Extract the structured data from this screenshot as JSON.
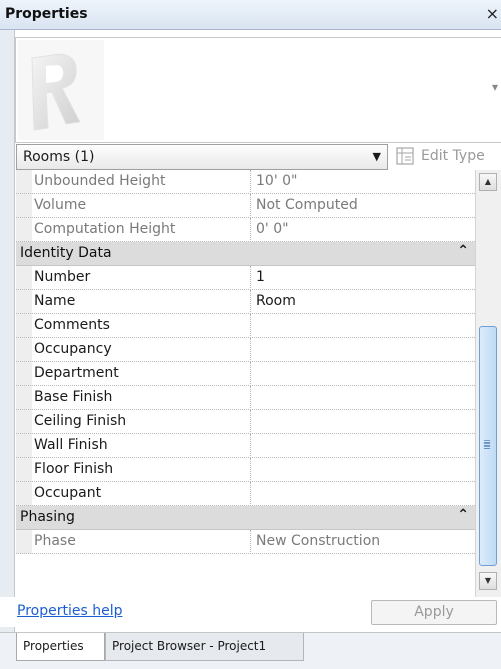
{
  "window": {
    "title": "Properties",
    "close": "×"
  },
  "type_selector": {
    "value": "Rooms (1)",
    "edit_type": "Edit Type"
  },
  "rows": [
    {
      "kind": "prop",
      "readonly": true,
      "key": "Unbounded Height",
      "value": "10'  0\""
    },
    {
      "kind": "prop",
      "readonly": true,
      "key": "Volume",
      "value": "Not Computed"
    },
    {
      "kind": "prop",
      "readonly": true,
      "key": "Computation Height",
      "value": "0'  0\""
    },
    {
      "kind": "group",
      "key": "Identity Data",
      "chevron": "⌃"
    },
    {
      "kind": "prop",
      "key": "Number",
      "value": "1"
    },
    {
      "kind": "prop",
      "key": "Name",
      "value": "Room"
    },
    {
      "kind": "prop",
      "key": "Comments",
      "value": ""
    },
    {
      "kind": "prop",
      "key": "Occupancy",
      "value": ""
    },
    {
      "kind": "prop",
      "key": "Department",
      "value": ""
    },
    {
      "kind": "prop",
      "key": "Base Finish",
      "value": ""
    },
    {
      "kind": "prop",
      "key": "Ceiling Finish",
      "value": ""
    },
    {
      "kind": "prop",
      "key": "Wall Finish",
      "value": ""
    },
    {
      "kind": "prop",
      "key": "Floor Finish",
      "value": ""
    },
    {
      "kind": "prop",
      "key": "Occupant",
      "value": ""
    },
    {
      "kind": "group",
      "key": "Phasing",
      "chevron": "⌃"
    },
    {
      "kind": "prop",
      "readonly": true,
      "key": "Phase",
      "value": "New Construction"
    }
  ],
  "footer": {
    "help_link": "Properties help",
    "apply": "Apply"
  },
  "tabs": [
    {
      "label": "Properties",
      "active": true
    },
    {
      "label": "Project Browser - Project1",
      "active": false
    }
  ],
  "icons": {
    "close": "close-icon",
    "scroll_up": "arrow-up-icon",
    "scroll_down": "arrow-down-icon",
    "dropdown": "chevron-down-icon",
    "edit_type": "edit-type-icon",
    "collapse": "collapse-group-icon"
  }
}
